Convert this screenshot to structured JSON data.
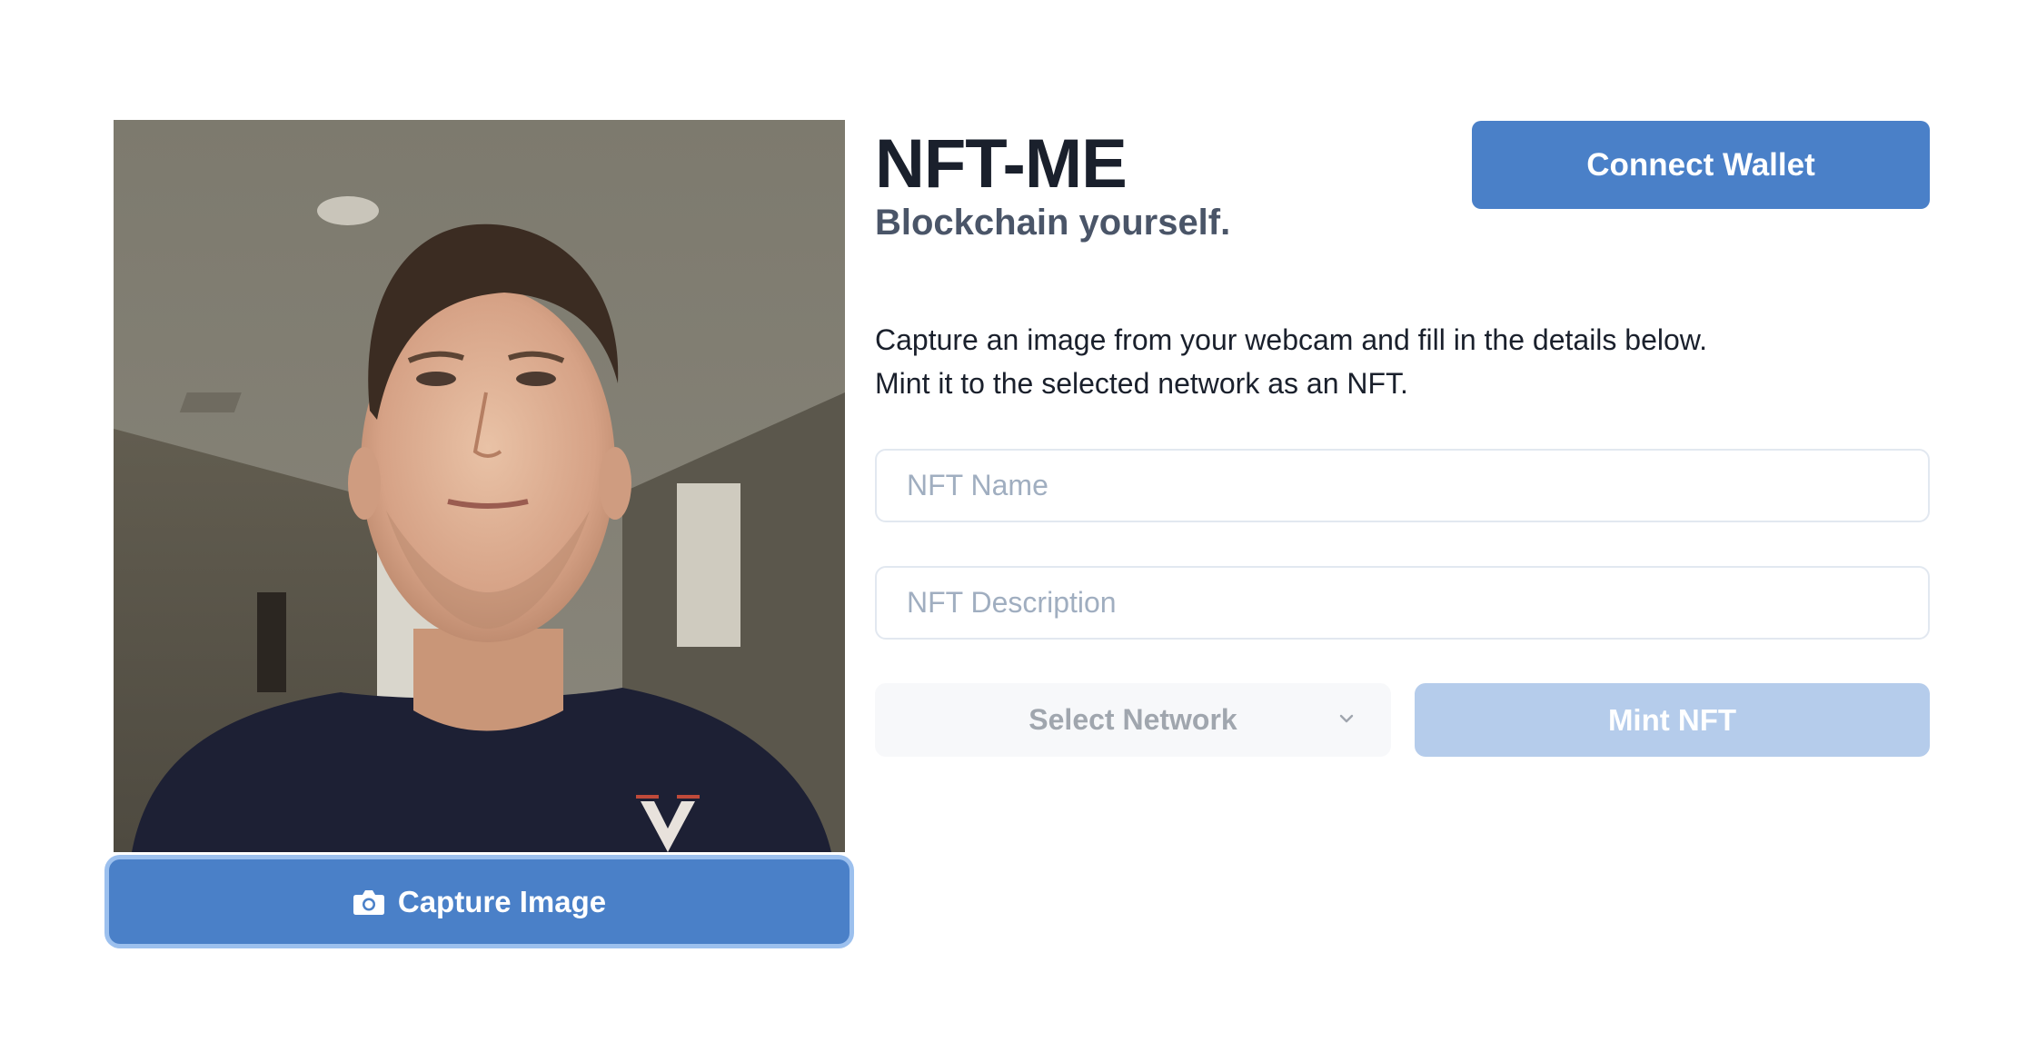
{
  "app": {
    "title": "NFT-ME",
    "subtitle": "Blockchain yourself."
  },
  "header": {
    "connect_wallet_label": "Connect Wallet"
  },
  "webcam": {
    "capture_label": "Capture Image",
    "capture_icon": "camera-icon"
  },
  "intro": {
    "line1": "Capture an image from your webcam and fill in the details below.",
    "line2": "Mint it to the selected network as an NFT."
  },
  "form": {
    "name_placeholder": "NFT Name",
    "name_value": "",
    "description_placeholder": "NFT Description",
    "description_value": "",
    "network_label": "Select Network",
    "network_icon": "chevron-down-icon",
    "mint_label": "Mint NFT"
  },
  "colors": {
    "primary": "#4a80c8",
    "primary_disabled": "#b5cceb",
    "focus_ring": "#9cc0ee",
    "heading": "#1a202c",
    "subheading": "#4a5568",
    "placeholder": "#a0aec0",
    "select_bg": "#f7f8fa"
  }
}
